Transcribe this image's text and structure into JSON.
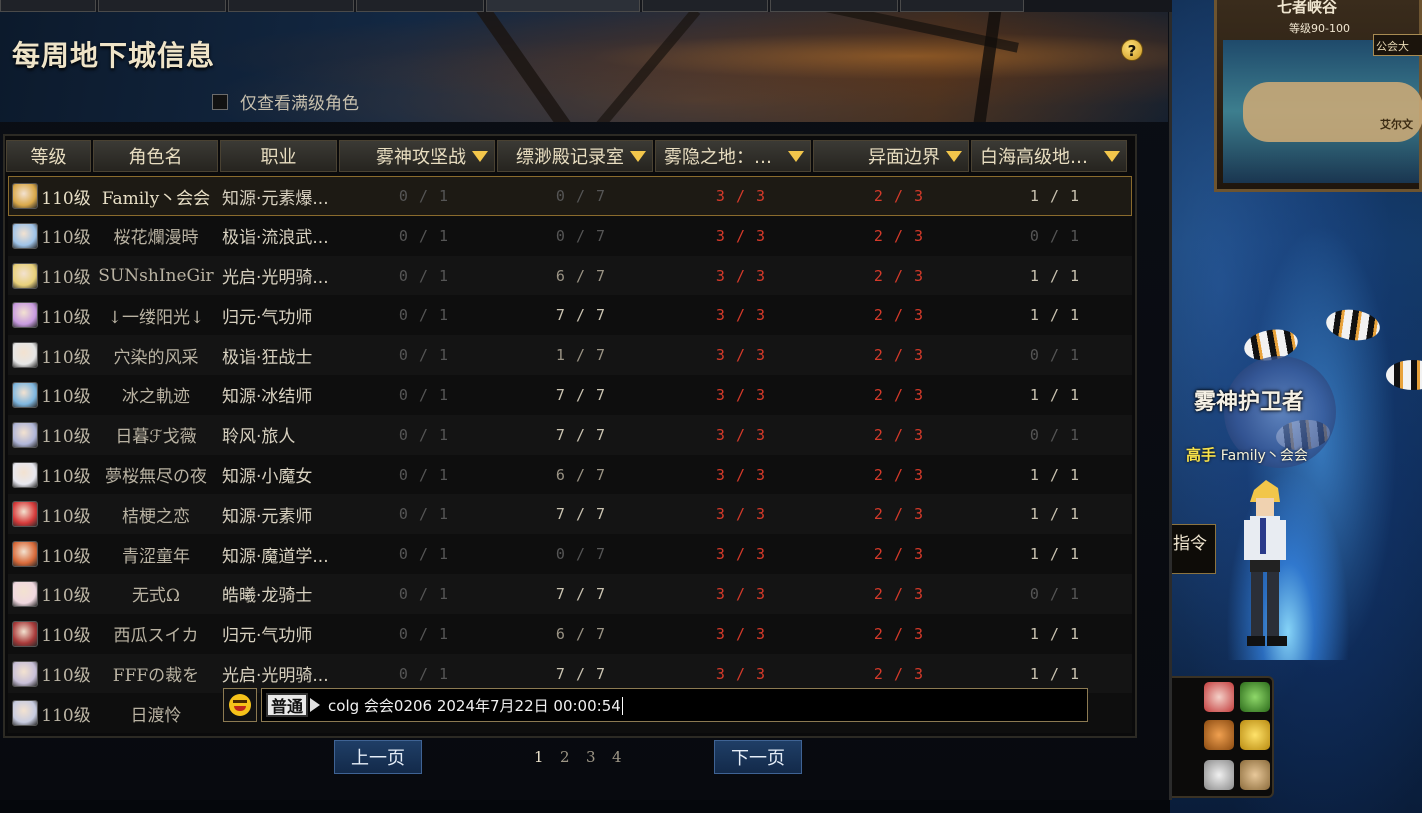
{
  "window": {
    "title": "每周地下城信息",
    "filter_label": "仅查看满级角色",
    "help_symbol": "?"
  },
  "columns": [
    "等级",
    "角色名",
    "职业",
    "雾神攻坚战",
    "缥渺殿记录室",
    "雾隐之地：雾...",
    "异面边界",
    "白海高级地下..."
  ],
  "rows": [
    {
      "level": "110级",
      "name": "Family丶会会",
      "job": "知源·元素爆...",
      "d": [
        "0 / 1",
        "0 / 7",
        "3 / 3",
        "2 / 3",
        "1 / 1"
      ],
      "avatar_color": "#d9a84a"
    },
    {
      "level": "110级",
      "name": "桜花爛漫時",
      "job": "极诣·流浪武...",
      "d": [
        "0 / 1",
        "0 / 7",
        "3 / 3",
        "2 / 3",
        "0 / 1"
      ],
      "avatar_color": "#9fc3e8"
    },
    {
      "level": "110级",
      "name": "SUNshΙneGir",
      "job": "光启·光明骑...",
      "d": [
        "0 / 1",
        "6 / 7",
        "3 / 3",
        "2 / 3",
        "1 / 1"
      ],
      "avatar_color": "#e8d07a"
    },
    {
      "level": "110级",
      "name": "↓一缕阳光↓",
      "job": "归元·气功师",
      "d": [
        "0 / 1",
        "7 / 7",
        "3 / 3",
        "2 / 3",
        "1 / 1"
      ],
      "avatar_color": "#c89be0"
    },
    {
      "level": "110级",
      "name": "穴染的风采",
      "job": "极诣·狂战士",
      "d": [
        "0 / 1",
        "1 / 7",
        "3 / 3",
        "2 / 3",
        "0 / 1"
      ],
      "avatar_color": "#e6e6e6"
    },
    {
      "level": "110级",
      "name": "冰之軌迹",
      "job": "知源·冰结师",
      "d": [
        "0 / 1",
        "7 / 7",
        "3 / 3",
        "2 / 3",
        "1 / 1"
      ],
      "avatar_color": "#7fb7e0"
    },
    {
      "level": "110级",
      "name": "日暮ℱ戈薇",
      "job": "聆风·旅人",
      "d": [
        "0 / 1",
        "7 / 7",
        "3 / 3",
        "2 / 3",
        "0 / 1"
      ],
      "avatar_color": "#b0b6d8"
    },
    {
      "level": "110级",
      "name": "夢桜無尽の夜",
      "job": "知源·小魔女",
      "d": [
        "0 / 1",
        "6 / 7",
        "3 / 3",
        "2 / 3",
        "1 / 1"
      ],
      "avatar_color": "#e8e8f0"
    },
    {
      "level": "110级",
      "name": "桔梗之恋",
      "job": "知源·元素师",
      "d": [
        "0 / 1",
        "7 / 7",
        "3 / 3",
        "2 / 3",
        "1 / 1"
      ],
      "avatar_color": "#d63a3a"
    },
    {
      "level": "110级",
      "name": "青涩童年",
      "job": "知源·魔道学...",
      "d": [
        "0 / 1",
        "0 / 7",
        "3 / 3",
        "2 / 3",
        "1 / 1"
      ],
      "avatar_color": "#d86a3a"
    },
    {
      "level": "110级",
      "name": "无式Ω",
      "job": "皓曦·龙骑士",
      "d": [
        "0 / 1",
        "7 / 7",
        "3 / 3",
        "2 / 3",
        "0 / 1"
      ],
      "avatar_color": "#f0d8e0"
    },
    {
      "level": "110级",
      "name": "西瓜スイカ",
      "job": "归元·气功师",
      "d": [
        "0 / 1",
        "6 / 7",
        "3 / 3",
        "2 / 3",
        "1 / 1"
      ],
      "avatar_color": "#a83a3a"
    },
    {
      "level": "110级",
      "name": "FFFの裁を",
      "job": "光启·光明骑...",
      "d": [
        "0 / 1",
        "7 / 7",
        "3 / 3",
        "2 / 3",
        "1 / 1"
      ],
      "avatar_color": "#c8c0d8"
    },
    {
      "level": "110级",
      "name": "日渡怜",
      "job": "",
      "d": [
        "",
        "",
        "",
        "",
        ""
      ],
      "avatar_color": "#c8cce0"
    }
  ],
  "chat": {
    "channel": "普通",
    "message": "colg 会会0206 2024年7月22日 00:00:54"
  },
  "pagination": {
    "prev": "上一页",
    "next": "下一页",
    "pages": [
      "1",
      "2",
      "3",
      "4"
    ],
    "current": "1"
  },
  "scene": {
    "map_title": "七者峡谷",
    "map_level": "等级90-100",
    "map_guild": "公会大",
    "map_label": "艾尔文",
    "guardian_title": "雾神护卫者",
    "npc_tag": "高手",
    "npc_name": "Family丶会会",
    "cmd_label": "指令"
  },
  "colors": {
    "red_progress": "#d43a2a",
    "accent_gold": "#f3c64b",
    "button_blue": "#1f3e66"
  }
}
